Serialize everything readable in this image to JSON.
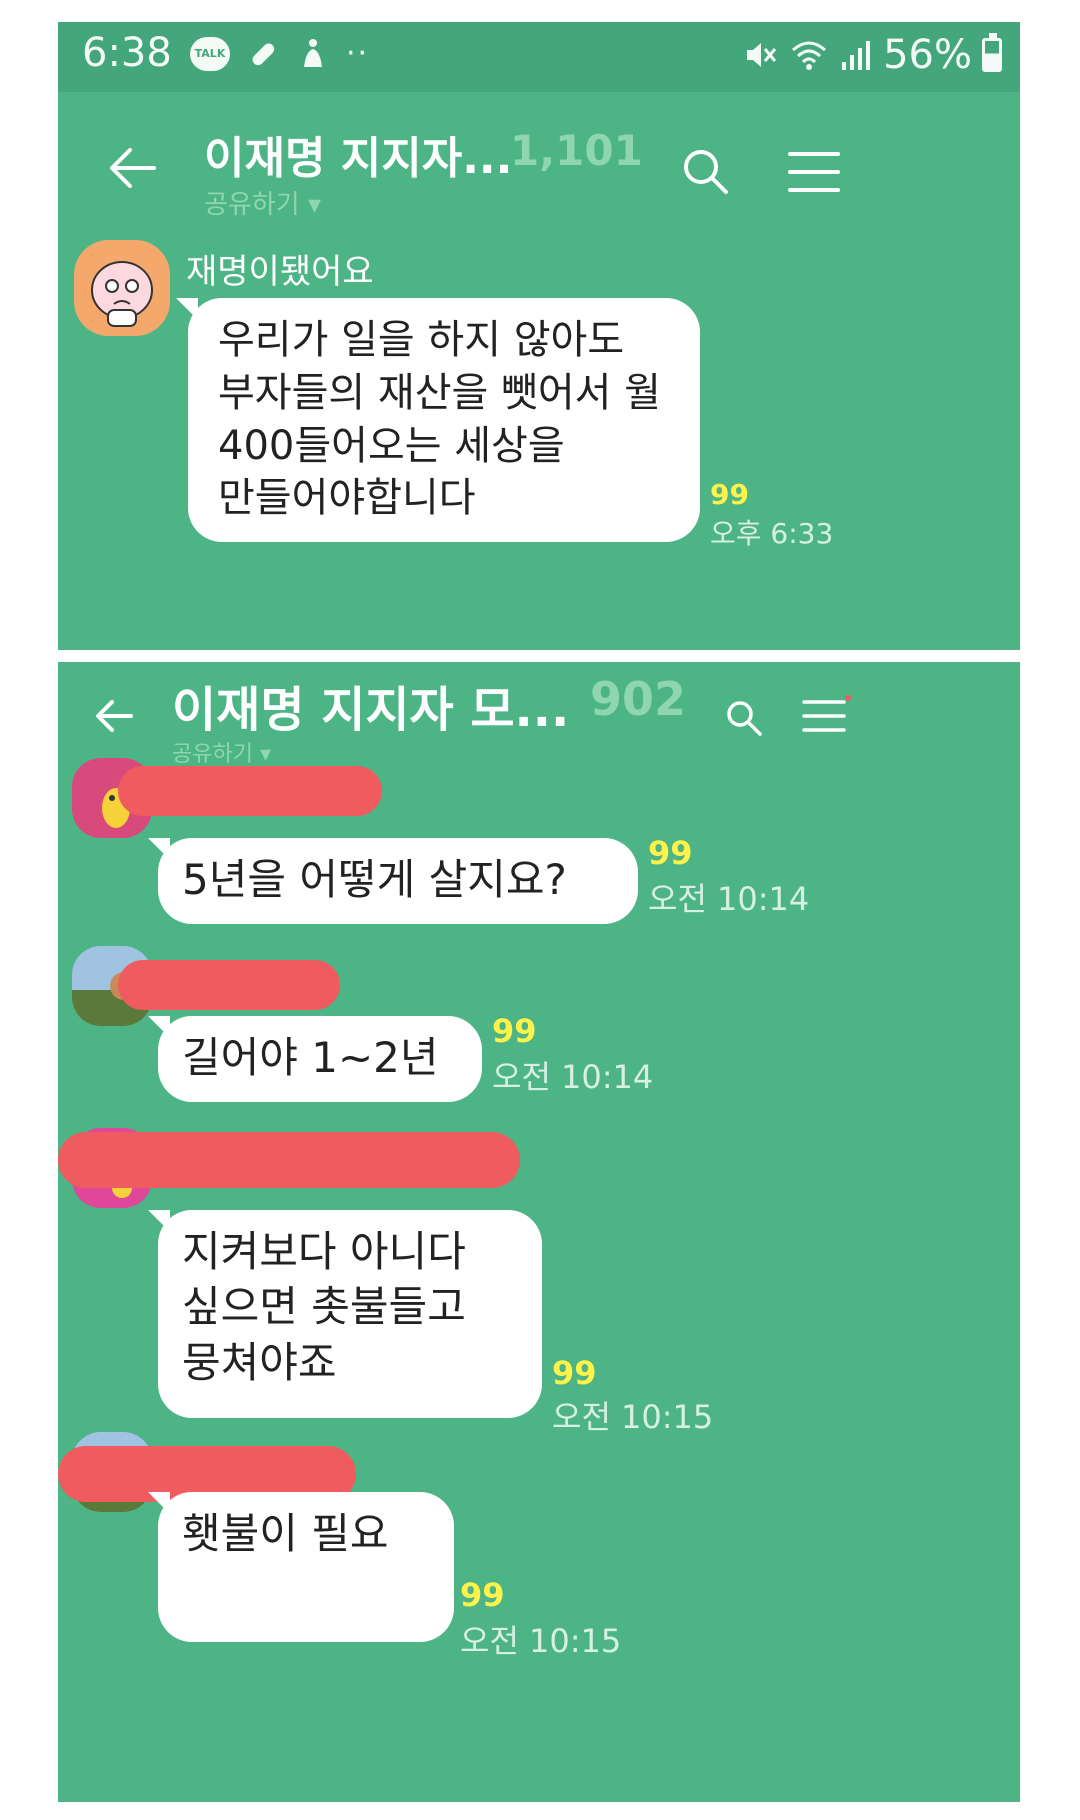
{
  "status_bar": {
    "time": "6:38",
    "talk_badge": "TALK",
    "battery": "56%"
  },
  "chat1": {
    "title": "이재명 지지자...",
    "member_count": "1,101",
    "share": "공유하기",
    "message": {
      "sender": "재명이됐어요",
      "lines": [
        "우리가 일을 하지 않아도",
        "부자들의 재산을 뺏어서 월",
        "400들어오는 세상을",
        "만들어야합니다"
      ],
      "read_count": "99",
      "time": "오후 6:33"
    }
  },
  "chat2": {
    "title": "이재명 지지자 모...",
    "member_count": "902",
    "share": "공유하기",
    "messages": [
      {
        "lines": [
          "5년을 어떻게 살지요?"
        ],
        "read_count": "99",
        "time": "오전 10:14"
      },
      {
        "lines": [
          "길어야 1~2년"
        ],
        "read_count": "99",
        "time": "오전 10:14"
      },
      {
        "lines": [
          "지켜보다 아니다",
          "싶으면 촛불들고",
          "뭉쳐야죠"
        ],
        "read_count": "99",
        "time": "오전 10:15"
      },
      {
        "lines": [
          "횃불이 필요"
        ],
        "read_count": "99",
        "time": "오전 10:15"
      }
    ]
  },
  "colors": {
    "chat_bg": "#4db486",
    "status_bg": "#43a77b",
    "read_count": "#fff24a",
    "redaction": "#ef5b5f"
  }
}
